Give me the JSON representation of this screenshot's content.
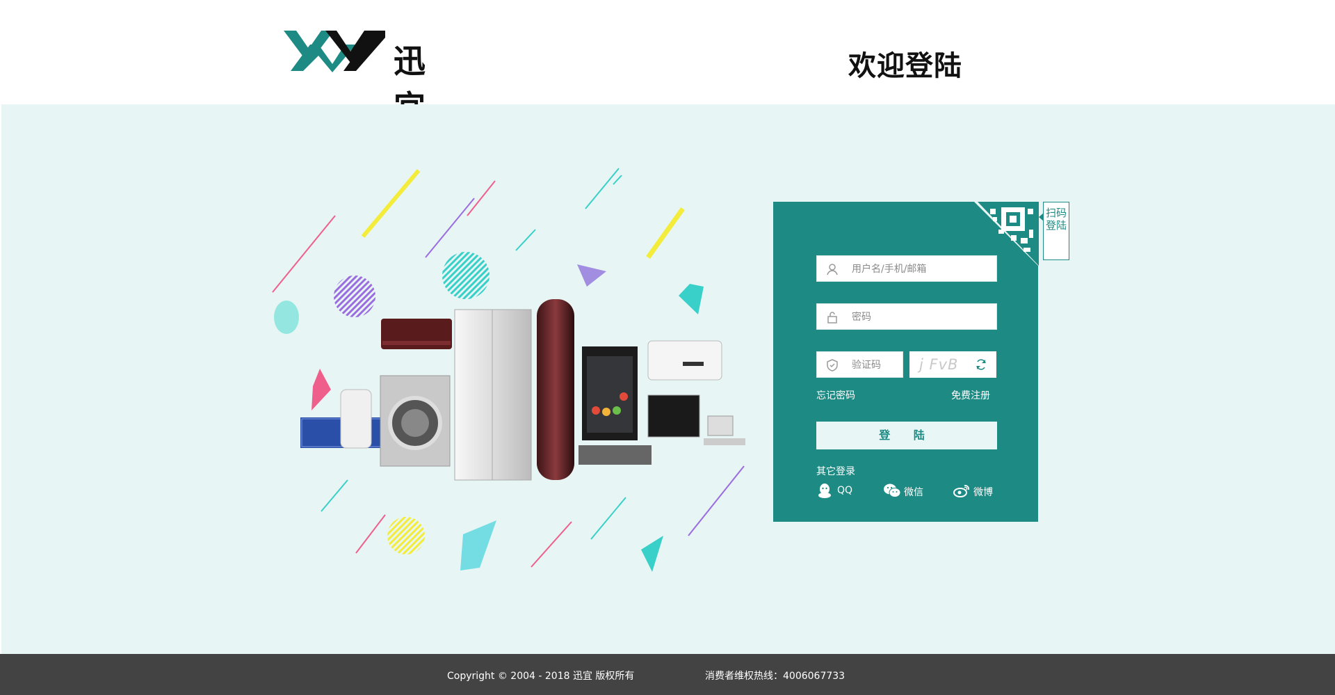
{
  "header": {
    "logo_text": "迅宜",
    "welcome": "欢迎登陆"
  },
  "login": {
    "username_placeholder": "用户名/手机/邮箱",
    "password_placeholder": "密码",
    "captcha_placeholder": "验证码",
    "captcha_code": "j FvB",
    "forgot_password": "忘记密码",
    "register": "免费注册",
    "login_button": "登 陆",
    "qr_tab": "扫码登陆",
    "other_login": "其它登录",
    "social": [
      {
        "label": "QQ",
        "icon": "qq-icon"
      },
      {
        "label": "微信",
        "icon": "wechat-icon"
      },
      {
        "label": "微博",
        "icon": "weibo-icon"
      }
    ]
  },
  "footer": {
    "copyright": "Copyright © 2004 - 2018  迅宜 版权所有",
    "hotline": "消费者维权热线：4006067733"
  },
  "colors": {
    "brand": "#1d8b84",
    "background": "#e7f5f4",
    "footer": "#434343"
  }
}
